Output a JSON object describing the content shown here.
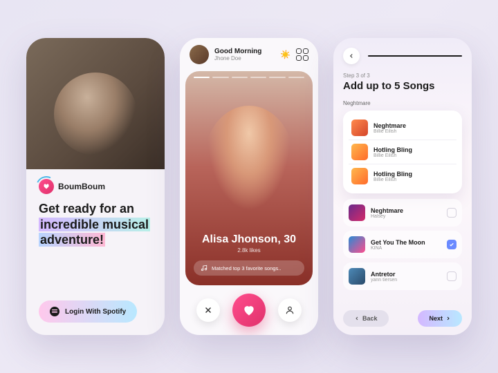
{
  "screen1": {
    "brand": "BoumBoum",
    "headline_l1": "Get ready for an",
    "headline_l2": "incredible musical",
    "headline_l3": "adventure!",
    "cta": "Login With Spotify"
  },
  "screen2": {
    "greeting": "Good Morning",
    "username": "Jhone Doe",
    "sun_icon": "☀️",
    "profile_name": "Alisa Jhonson, 30",
    "likes": "2.8k likes",
    "match_text": "Matched top 3 favorite songs..",
    "stories_total": 6,
    "stories_active": 0
  },
  "screen3": {
    "step": "Step 3 of 3",
    "title": "Add up to 5 Songs",
    "search_value": "Neghtmare",
    "dropdown": [
      {
        "title": "Neghtmare",
        "artist": "Billie Eilish",
        "cover": "c1"
      },
      {
        "title": "Hotling Bling",
        "artist": "Billie Eilish",
        "cover": "c2"
      },
      {
        "title": "Hotling Bling",
        "artist": "Billie Eilish",
        "cover": "c2"
      }
    ],
    "selections": [
      {
        "title": "Neghtmare",
        "artist": "Halsey",
        "cover": "c3",
        "checked": false
      },
      {
        "title": "Get You The Moon",
        "artist": "KINA",
        "cover": "c4",
        "checked": true
      },
      {
        "title": "Antretor",
        "artist": "yann tiersen",
        "cover": "c5",
        "checked": false
      }
    ],
    "back": "Back",
    "next": "Next"
  }
}
